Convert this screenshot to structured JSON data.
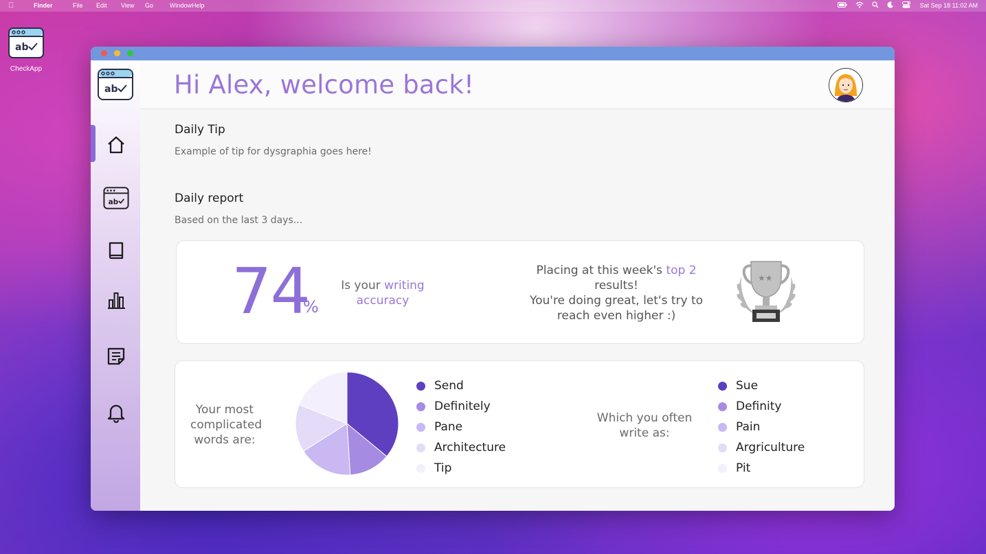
{
  "menubar": {
    "app_name": "Finder",
    "menus": [
      "File",
      "Edit",
      "View",
      "Go",
      "WindowHelp"
    ],
    "clock": "Sat Sep 18  11:02 AM"
  },
  "desktop": {
    "icon_label": "CheckApp"
  },
  "app": {
    "greeting": "Hi Alex, welcome back!",
    "nav": [
      "home-icon",
      "checker-icon",
      "book-icon",
      "stats-icon",
      "notes-icon",
      "bell-icon"
    ],
    "daily_tip": {
      "title": "Daily Tip",
      "text": "Example of tip for dysgraphia goes here!"
    },
    "daily_report": {
      "title": "Daily report",
      "subtitle": "Based on the last 3 days..."
    },
    "accuracy": {
      "value": "74",
      "unit": "%",
      "text_prefix": "Is your ",
      "text_highlight": "writing accuracy"
    },
    "placing": {
      "prefix": "Placing at this week's ",
      "highlight": "top 2",
      "line2": "results!",
      "line3": "You're doing great, let's try to reach even higher :)"
    },
    "words": {
      "label": "Your most complicated words are:",
      "often_label": "Which you often write as:",
      "correct": [
        "Send",
        "Definitely",
        "Pane",
        "Architecture",
        "Tip"
      ],
      "misspelled": [
        "Sue",
        "Definity",
        "Pain",
        "Argriculture",
        "Pit"
      ],
      "colors": [
        "#5e3fc0",
        "#a68be3",
        "#c9b8f2",
        "#e4dbf8",
        "#f3effc"
      ]
    }
  },
  "chart_data": {
    "type": "pie",
    "categories": [
      "Send",
      "Definitely",
      "Pane",
      "Architecture",
      "Tip"
    ],
    "values": [
      36,
      13,
      17,
      15,
      19
    ]
  }
}
